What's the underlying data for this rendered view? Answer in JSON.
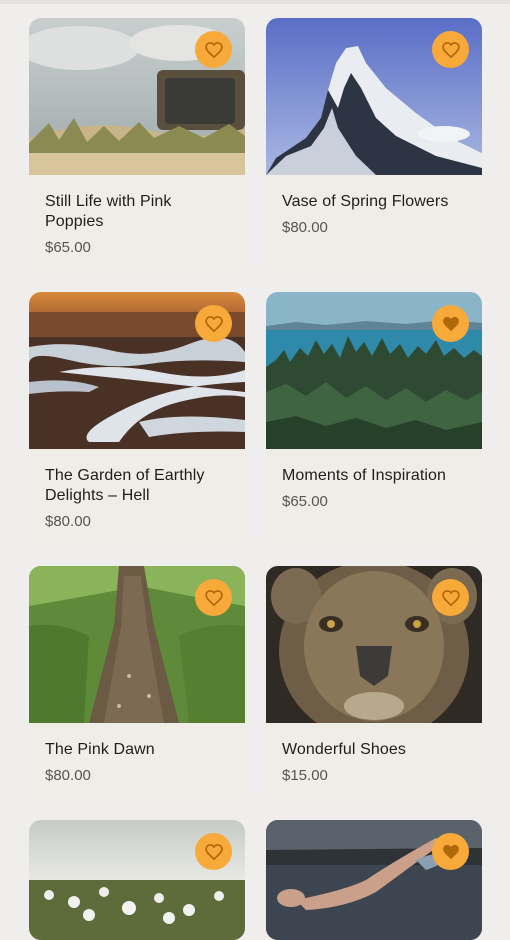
{
  "colors": {
    "background": "#efeeec",
    "card": "#f0ede6",
    "favorite_button": "#f7a93a",
    "heart": "#b06808"
  },
  "products": [
    {
      "title": "Still Life with Pink Poppies",
      "price": "$65.00",
      "favorited": false,
      "image": "old-tv-on-sand-dune"
    },
    {
      "title": "Vase of Spring Flowers",
      "price": "$80.00",
      "favorited": false,
      "image": "matterhorn-mountain-peak"
    },
    {
      "title": "The Garden of Earthly Delights – Hell",
      "price": "$80.00",
      "favorited": false,
      "image": "frozen-muddy-ground"
    },
    {
      "title": "Moments of Inspiration",
      "price": "$65.00",
      "favorited": true,
      "image": "pine-forest-by-sea"
    },
    {
      "title": "The Pink Dawn",
      "price": "$80.00",
      "favorited": false,
      "image": "dirt-path-through-grass"
    },
    {
      "title": "Wonderful Shoes",
      "price": "$15.00",
      "favorited": false,
      "image": "lioness-face-close-up"
    },
    {
      "title": "",
      "price": "",
      "favorited": false,
      "image": "dandelion-field"
    },
    {
      "title": "",
      "price": "",
      "favorited": true,
      "image": "swimmer-in-water"
    }
  ]
}
